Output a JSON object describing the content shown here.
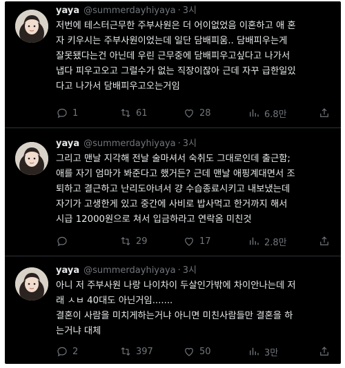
{
  "tweets": [
    {
      "name": "yaya",
      "handle": "@summerdayhiyaya",
      "dot": "·",
      "time": "3시",
      "lines": [
        "저번에 테스터근무한 주부사원은 더 어이없었음 이혼하고 애 혼",
        "자 키우시는 주부사원이었는데 일단 담배피움.. 담배피우는게",
        "잘못됐다는건 아닌데 우린 근무중에 담배피우고싶다고 나가서",
        "냅다 피우고오고 그럴수가 없는 직장이잖아 근데 자꾸 급한일있",
        "다고 나가서 담배피우고오는거임"
      ],
      "replies": "1",
      "retweets": "61",
      "likes": "28",
      "views": "6.8만"
    },
    {
      "name": "yaya",
      "handle": "@summerdayhiyaya",
      "dot": "·",
      "time": "3시",
      "lines": [
        "그리고 맨날 지각해 전날 술마셔서 숙취도 그대로인데 출근함;",
        "애를 자기 엄마가 봐준다고 했거든? 근데 맨날 애핑계대면서 조",
        "퇴하고 결근하고 난리도아녀서 걍 수습종료시키고 내보냈는데",
        "자기가 고생한게 있고 중간에 사비로 밥사먹고 한거까지 해서",
        "시급 12000원으로 쳐서 입금하라고 연락옴 미친것"
      ],
      "replies": "",
      "retweets": "29",
      "likes": "17",
      "views": "2.8만"
    },
    {
      "name": "yaya",
      "handle": "@summerdayhiyaya",
      "dot": "·",
      "time": "3시",
      "lines": [
        "아니 저 주부사원 나랑 나이차이 두살인가밖에 차이안나는데 저",
        "래 ㅅㅂ 40대도 아닌거임.......",
        "결혼이 사람을 미치게하는거냐 아니면 미친사람들만 결혼을 하",
        "는거냐 대체"
      ],
      "replies": "2",
      "retweets": "397",
      "likes": "50",
      "views": "3만"
    }
  ],
  "icons": {
    "reply": "reply-icon",
    "retweet": "retweet-icon",
    "like": "like-icon",
    "views": "views-icon",
    "share": "share-icon"
  },
  "colors": {
    "background": "#000000",
    "text": "#e7e9ea",
    "muted": "#71767b",
    "divider": "#2f3336"
  }
}
